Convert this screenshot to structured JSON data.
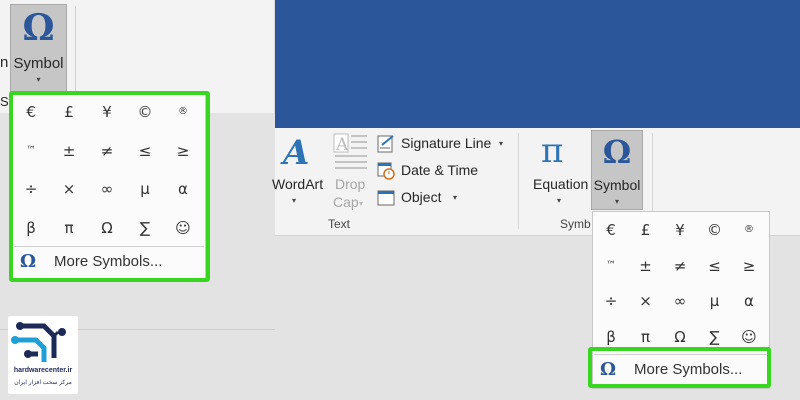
{
  "left": {
    "clipped_label_left": "n",
    "symbol_label": "Symbol",
    "clipped_group_label": "Symbo",
    "more_symbols_label": "More Symbols..."
  },
  "ribbon": {
    "wordart_label": "WordArt",
    "dropcap_label_line1": "Drop",
    "dropcap_label_line2": "Cap",
    "signature_line_label": "Signature Line",
    "date_time_label": "Date & Time",
    "object_label": "Object",
    "text_group_label": "Text",
    "equation_label": "Equation",
    "symbol_label": "Symbol",
    "symbols_group_label": "Symb"
  },
  "symbols": [
    "€",
    "£",
    "¥",
    "©",
    "®",
    "™",
    "±",
    "≠",
    "≤",
    "≥",
    "÷",
    "×",
    "∞",
    "µ",
    "α",
    "β",
    "π",
    "Ω",
    "∑",
    "☺"
  ],
  "right_dropdown": {
    "more_symbols_label": "More Symbols..."
  },
  "logo": {
    "site": "hardwarecenter.ir",
    "tagline": "مرکز سخت افزار ایران"
  },
  "colors": {
    "titlebar": "#2b579a",
    "highlight": "#39d621",
    "ribbon": "#f3f3f3",
    "icon_blue": "#2e74b5"
  },
  "icons": {
    "omega": "Ω",
    "pi": "π",
    "wordart": "A",
    "chevron": "▾"
  }
}
